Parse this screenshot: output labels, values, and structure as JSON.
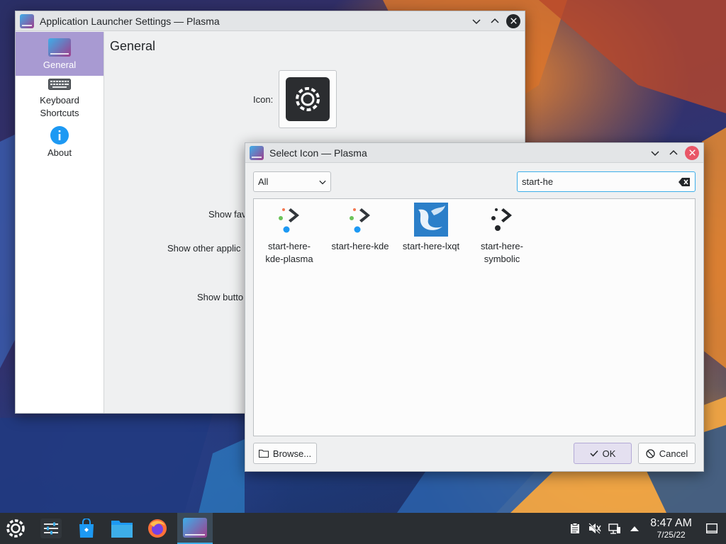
{
  "settings_window": {
    "title": "Application Launcher Settings — Plasma",
    "sidebar": [
      {
        "label": "General"
      },
      {
        "label": "Keyboard\nShortcuts"
      },
      {
        "label": "About"
      }
    ],
    "page_title": "General",
    "icon_label": "Icon:",
    "labels": {
      "show_favorites": "Show fav",
      "show_other_apps": "Show other applic",
      "show_buttons": "Show butto"
    }
  },
  "dialog": {
    "title": "Select Icon — Plasma",
    "filter_value": "All",
    "search_value": "start-he",
    "icons": [
      {
        "name": "start-here-\nkde-plasma",
        "icon": "kde-plasma-icon"
      },
      {
        "name": "start-here-kde",
        "icon": "kde-icon"
      },
      {
        "name": "start-here-lxqt",
        "icon": "lxqt-icon"
      },
      {
        "name": "start-here-\nsymbolic",
        "icon": "symbolic-icon"
      }
    ],
    "browse_label": "Browse...",
    "ok_label": "OK",
    "cancel_label": "Cancel"
  },
  "taskbar": {
    "items": [
      "app-launcher-icon",
      "system-settings-icon",
      "discover-icon",
      "dolphin-icon",
      "firefox-icon",
      "launcher-settings-icon"
    ],
    "tray": [
      "clipboard-icon",
      "volume-muted-icon",
      "network-icon",
      "expand-tray-icon"
    ],
    "clock": {
      "time": "8:47 AM",
      "date": "7/25/22"
    }
  },
  "colors": {
    "accent": "#3daee9",
    "selection": "#a89ad2",
    "close_red": "#e95667"
  }
}
